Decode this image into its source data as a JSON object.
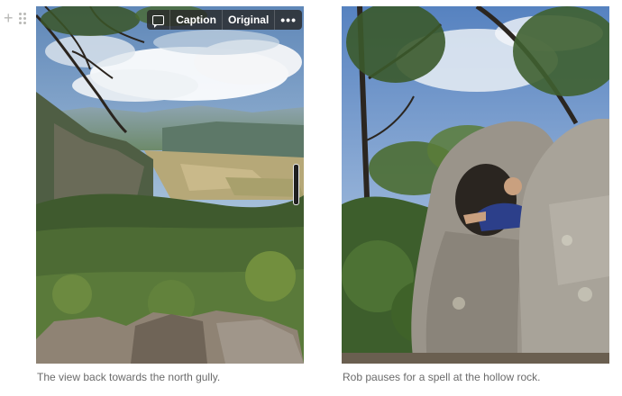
{
  "toolbar": {
    "caption_label": "Caption",
    "original_label": "Original",
    "more_label": "•••",
    "icons": [
      "comment-icon",
      "more-icon"
    ]
  },
  "images": [
    {
      "alt": "Valley view from cliff",
      "caption": "The view back towards the north gully."
    },
    {
      "alt": "Man sitting inside hollow rock",
      "caption": "Rob pauses for a spell at the hollow rock."
    }
  ],
  "colors": {
    "caption_text": "#6b6b6b",
    "toolbar_bg": "#282828"
  }
}
